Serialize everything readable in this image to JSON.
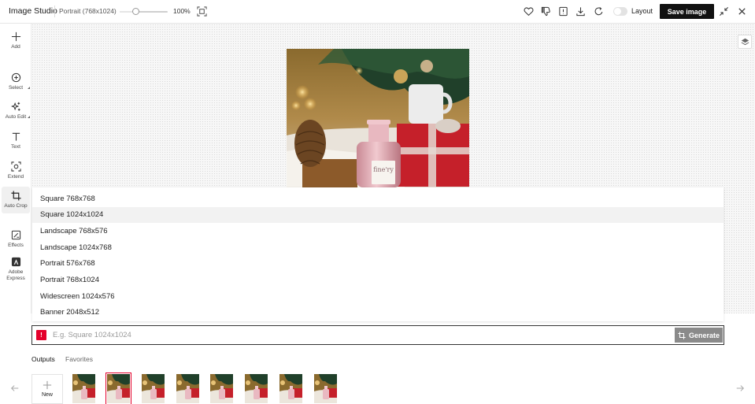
{
  "app": {
    "title": "Image Studio",
    "size_label": "Portrait (768x1024)"
  },
  "toolbar": {
    "zoom_percent": "100%",
    "zoom_value": 0.33,
    "layout_label": "Layout",
    "layout_on": false,
    "save_label": "Save image"
  },
  "sidebar": {
    "tools": [
      {
        "label": "Add",
        "icon": "plus-icon"
      },
      {
        "label": "Select",
        "icon": "select-icon"
      },
      {
        "label": "Auto Edit",
        "icon": "sparkle-icon"
      },
      {
        "label": "Text",
        "icon": "text-icon"
      },
      {
        "label": "Extend",
        "icon": "extend-icon"
      },
      {
        "label": "Auto Crop",
        "icon": "crop-icon"
      },
      {
        "label": "Effects",
        "icon": "effects-icon"
      },
      {
        "label": "Adobe Express",
        "icon": "adobe-express-icon"
      }
    ],
    "active": "Auto Crop"
  },
  "canvas": {
    "product_label": "fine'ry"
  },
  "crop_menu": {
    "items": [
      "Square 768x768",
      "Square 1024x1024",
      "Landscape 768x576",
      "Landscape 1024x768",
      "Portrait 576x768",
      "Portrait 768x1024",
      "Widescreen 1024x576",
      "Banner 2048x512"
    ],
    "highlighted": "Square 1024x1024"
  },
  "prompt": {
    "badge": "!",
    "value": "",
    "placeholder": "E.g. Square 1024x1024",
    "generate_label": "Generate"
  },
  "outputs": {
    "tabs": [
      "Outputs",
      "Favorites"
    ],
    "active_tab": "Outputs",
    "new_label": "New",
    "thumbnail_count": 8,
    "selected_index": 1
  },
  "colors": {
    "accent": "#e4002b",
    "save_bg": "#111111",
    "generate_bg": "#8a8a8a"
  }
}
